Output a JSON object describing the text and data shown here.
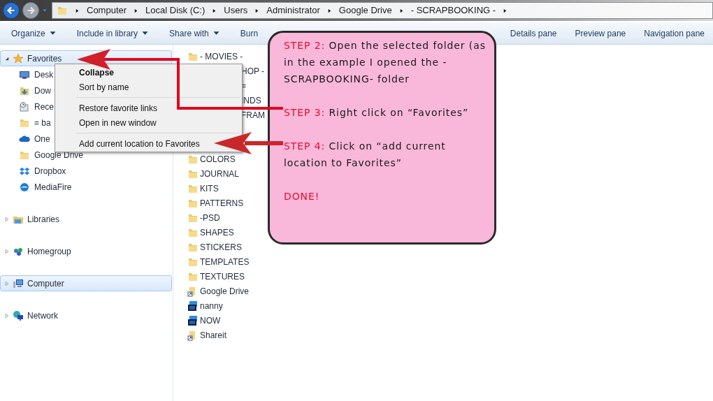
{
  "address_bar": {
    "crumbs": [
      "Computer",
      "Local Disk (C:)",
      "Users",
      "Administrator",
      "Google Drive",
      "- SCRAPBOOKING -"
    ]
  },
  "toolbar": {
    "left": [
      {
        "label": "Organize",
        "dropdown": true
      },
      {
        "label": "Include in library",
        "dropdown": true
      },
      {
        "label": "Share with",
        "dropdown": true
      },
      {
        "label": "Burn",
        "dropdown": false
      }
    ],
    "right": [
      {
        "label": "Details pane",
        "dropdown": false
      },
      {
        "label": "Preview pane",
        "dropdown": false
      },
      {
        "label": "Navigation pane",
        "dropdown": false
      }
    ]
  },
  "navigation": [
    {
      "label": "Favorites",
      "kind": "star",
      "expanded": true,
      "selected": true,
      "children": [
        {
          "label": "Desk",
          "kind": "desktop"
        },
        {
          "label": "Dow",
          "kind": "downloads"
        },
        {
          "label": "Rece",
          "kind": "recent"
        },
        {
          "label": "= ba",
          "kind": "folder"
        },
        {
          "label": "One",
          "kind": "cloud"
        },
        {
          "label": "Google Drive",
          "kind": "folder"
        },
        {
          "label": "Dropbox",
          "kind": "dropbox"
        },
        {
          "label": "MediaFire",
          "kind": "mediafire"
        }
      ]
    },
    {
      "label": "Libraries",
      "kind": "libraries",
      "expanded": false,
      "selected": false
    },
    {
      "label": "Homegroup",
      "kind": "homegroup",
      "expanded": false,
      "selected": false
    },
    {
      "label": "Computer",
      "kind": "computer",
      "expanded": false,
      "selected": true
    },
    {
      "label": "Network",
      "kind": "network",
      "expanded": false,
      "selected": false
    }
  ],
  "files_top": [
    {
      "name": "- MOVIES -",
      "kind": "folder"
    },
    {
      "name": "HOP -",
      "kind": "covered"
    },
    {
      "name": "=",
      "kind": "covered"
    },
    {
      "name": "INDS",
      "kind": "covered"
    },
    {
      "name": "FRAM",
      "kind": "covered"
    }
  ],
  "files": [
    {
      "name": "COLORS",
      "kind": "folder"
    },
    {
      "name": "JOURNAL",
      "kind": "folder"
    },
    {
      "name": "KITS",
      "kind": "folder"
    },
    {
      "name": "PATTERNS",
      "kind": "folder"
    },
    {
      "name": "-PSD",
      "kind": "folder"
    },
    {
      "name": "SHAPES",
      "kind": "folder"
    },
    {
      "name": "STICKERS",
      "kind": "folder"
    },
    {
      "name": "TEMPLATES",
      "kind": "folder"
    },
    {
      "name": "TEXTURES",
      "kind": "folder"
    },
    {
      "name": "Google Drive",
      "kind": "shortcut"
    },
    {
      "name": "nanny",
      "kind": "psd"
    },
    {
      "name": "NOW",
      "kind": "psd"
    },
    {
      "name": "Shareit",
      "kind": "shortcut"
    }
  ],
  "context_menu": {
    "sections": [
      {
        "items": [
          {
            "label": "Collapse",
            "bold": true
          },
          {
            "label": "Sort by name",
            "bold": false
          }
        ]
      },
      {
        "items": [
          {
            "label": "Restore favorite links",
            "bold": false
          },
          {
            "label": "Open in new window",
            "bold": false
          }
        ]
      },
      {
        "items": [
          {
            "label": "Add current location to Favorites",
            "bold": false
          }
        ]
      }
    ]
  },
  "note": {
    "steps": [
      {
        "label": "STEP 2:",
        "text": "Open the selected folder (as in the example I opened the -SCRAPBOOKING- folder"
      },
      {
        "label": "STEP 3:",
        "text": "Right click on “Favorites”"
      },
      {
        "label": "STEP 4:",
        "text": "Click on “add current location to Favorites”"
      }
    ],
    "done": "DONE!"
  }
}
